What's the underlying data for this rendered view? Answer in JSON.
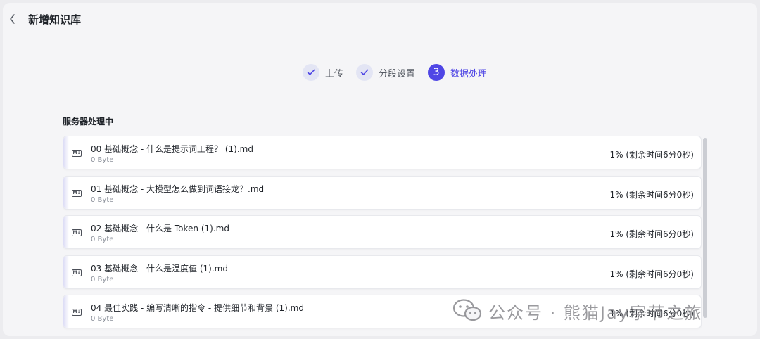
{
  "header": {
    "title": "新增知识库",
    "back_icon": "chevron-left-icon"
  },
  "steps": [
    {
      "label": "上传",
      "status": "done",
      "icon": "check-icon"
    },
    {
      "label": "分段设置",
      "status": "done",
      "icon": "check-icon"
    },
    {
      "number": "3",
      "label": "数据处理",
      "status": "active"
    }
  ],
  "section_title": "服务器处理中",
  "files": [
    {
      "name": "00 基础概念 - 什么是提示词工程？ (1).md",
      "size": "0 Byte",
      "progress": "1% (剩余时间6分0秒)"
    },
    {
      "name": "01 基础概念 - 大模型怎么做到词语接龙？.md",
      "size": "0 Byte",
      "progress": "1% (剩余时间6分0秒)"
    },
    {
      "name": "02 基础概念 - 什么是 Token (1).md",
      "size": "0 Byte",
      "progress": "1% (剩余时间6分0秒)"
    },
    {
      "name": "03 基础概念 - 什么是温度值 (1).md",
      "size": "0 Byte",
      "progress": "1% (剩余时间6分0秒)"
    },
    {
      "name": "04 最佳实践 - 编写清晰的指令 - 提供细节和背景 (1).md",
      "size": "0 Byte",
      "progress": "1% (剩余时间6分0秒)"
    }
  ],
  "file_icon_label": "M↓",
  "watermark": {
    "text": "公众号 · 熊猫Jay字节之旅",
    "icon": "wechat-icon"
  },
  "colors": {
    "accent": "#4f46e5",
    "step_done_bg": "#e3e5f4"
  }
}
